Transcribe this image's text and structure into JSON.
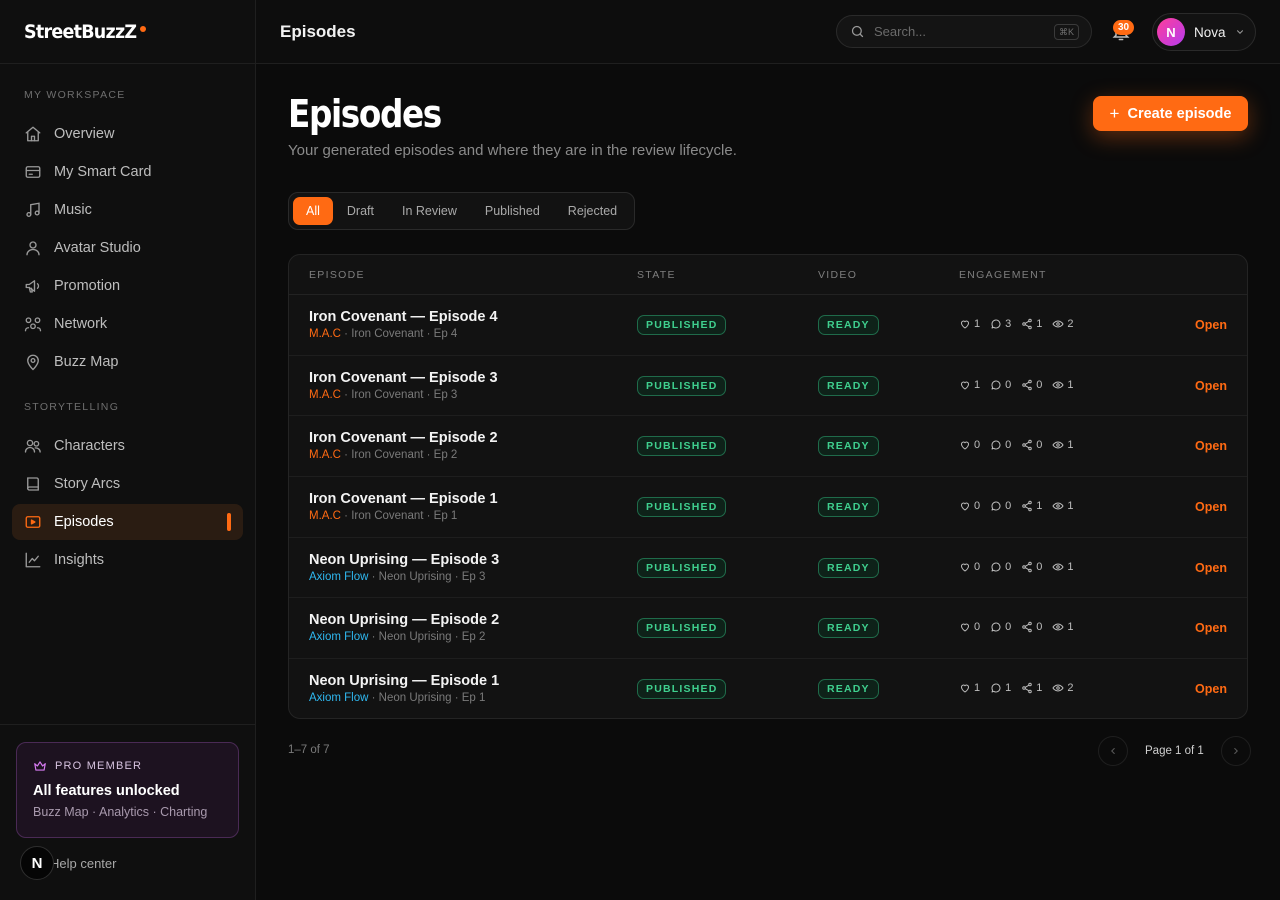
{
  "brand": {
    "name": "StreetBuzzZ"
  },
  "sidebar": {
    "sections": [
      {
        "label": "MY WORKSPACE",
        "items": [
          {
            "label": "Overview",
            "icon": "home-icon"
          },
          {
            "label": "My Smart Card",
            "icon": "card-icon"
          },
          {
            "label": "Music",
            "icon": "music-icon"
          },
          {
            "label": "Avatar Studio",
            "icon": "user-icon"
          },
          {
            "label": "Promotion",
            "icon": "megaphone-icon"
          },
          {
            "label": "Network",
            "icon": "network-icon"
          },
          {
            "label": "Buzz Map",
            "icon": "map-pin-icon"
          }
        ]
      },
      {
        "label": "STORYTELLING",
        "items": [
          {
            "label": "Characters",
            "icon": "characters-icon"
          },
          {
            "label": "Story Arcs",
            "icon": "book-icon"
          },
          {
            "label": "Episodes",
            "icon": "video-icon",
            "active": true
          },
          {
            "label": "Insights",
            "icon": "chart-icon"
          }
        ]
      }
    ],
    "pro": {
      "badge": "PRO MEMBER",
      "title": "All features unlocked",
      "subtitle": "Buzz Map · Analytics · Charting"
    },
    "help": {
      "badge": "N",
      "label": "Help center"
    }
  },
  "topbar": {
    "title": "Episodes",
    "search_placeholder": "Search...",
    "search_shortcut": "⌘K",
    "notifications": "30",
    "user": {
      "initial": "N",
      "name": "Nova"
    }
  },
  "header": {
    "title": "Episodes",
    "subtitle": "Your generated episodes and where they are in the review lifecycle.",
    "create_label": "Create episode"
  },
  "filters": {
    "tabs": [
      "All",
      "Draft",
      "In Review",
      "Published",
      "Rejected"
    ],
    "active": "All"
  },
  "table": {
    "columns": [
      "EPISODE",
      "STATE",
      "VIDEO",
      "ENGAGEMENT"
    ],
    "open_label": "Open",
    "rows": [
      {
        "title": "Iron Covenant — Episode 4",
        "author": "M.A.C",
        "author_color": "#ff6a13",
        "series": "Iron Covenant · Ep 4",
        "state": "PUBLISHED",
        "video": "READY",
        "likes": "1",
        "comments": "3",
        "shares": "1",
        "views": "2"
      },
      {
        "title": "Iron Covenant — Episode 3",
        "author": "M.A.C",
        "author_color": "#ff6a13",
        "series": "Iron Covenant · Ep 3",
        "state": "PUBLISHED",
        "video": "READY",
        "likes": "1",
        "comments": "0",
        "shares": "0",
        "views": "1"
      },
      {
        "title": "Iron Covenant — Episode 2",
        "author": "M.A.C",
        "author_color": "#ff6a13",
        "series": "Iron Covenant · Ep 2",
        "state": "PUBLISHED",
        "video": "READY",
        "likes": "0",
        "comments": "0",
        "shares": "0",
        "views": "1"
      },
      {
        "title": "Iron Covenant — Episode 1",
        "author": "M.A.C",
        "author_color": "#ff6a13",
        "series": "Iron Covenant · Ep 1",
        "state": "PUBLISHED",
        "video": "READY",
        "likes": "0",
        "comments": "0",
        "shares": "1",
        "views": "1"
      },
      {
        "title": "Neon Uprising — Episode 3",
        "author": "Axiom Flow",
        "author_color": "#2fb8f0",
        "series": "Neon Uprising · Ep 3",
        "state": "PUBLISHED",
        "video": "READY",
        "likes": "0",
        "comments": "0",
        "shares": "0",
        "views": "1"
      },
      {
        "title": "Neon Uprising — Episode 2",
        "author": "Axiom Flow",
        "author_color": "#2fb8f0",
        "series": "Neon Uprising · Ep 2",
        "state": "PUBLISHED",
        "video": "READY",
        "likes": "0",
        "comments": "0",
        "shares": "0",
        "views": "1"
      },
      {
        "title": "Neon Uprising — Episode 1",
        "author": "Axiom Flow",
        "author_color": "#2fb8f0",
        "series": "Neon Uprising · Ep 1",
        "state": "PUBLISHED",
        "video": "READY",
        "likes": "1",
        "comments": "1",
        "shares": "1",
        "views": "2"
      }
    ]
  },
  "footer": {
    "count": "1–7 of 7",
    "page_label": "Page 1 of 1"
  },
  "colors": {
    "accent": "#ff6a13",
    "success": "#3fcf8e",
    "background": "#0b0b0b"
  }
}
